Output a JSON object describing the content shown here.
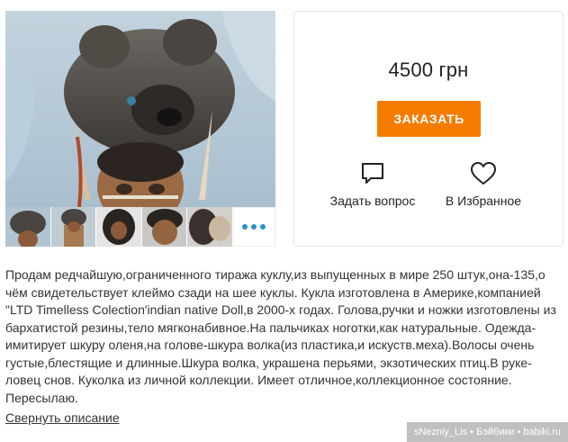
{
  "gallery": {
    "more_label": "•••",
    "main_photo_alt": "Indian native doll in wolf pelt headdress",
    "thumbnails": [
      "thumb-1",
      "thumb-2",
      "thumb-3",
      "thumb-4",
      "thumb-5"
    ]
  },
  "purchase": {
    "price": "4500 грн",
    "order_label": "ЗАКАЗАТЬ",
    "ask_label": "Задать вопрос",
    "favorite_label": "В Избранное",
    "accent_color": "#f57c00"
  },
  "icons": {
    "ask": "speech-bubble-icon",
    "favorite": "heart-icon"
  },
  "description": {
    "text": "Продам редчайшую,ограниченного тиража куклу,из выпущенных в мире 250 штук,она-135,о чём свидетельствует клеймо сзади на шее куклы. Кукла изготовлена в Америке,компанией \"LTD Timelless Colection'indian native Doll,в 2000-х годах. Голова,ручки и ножки изготовлены из бархатистой резины,тело мягконабивное.На пальчиках ноготки,как натуральные. Одежда-имитирует шкуру оленя,на голове-шкура волка(из пластика,и искуств.меха).Волосы очень густые,блестящие и длинные.Шкура волка, украшена перьями, экзотических птиц.В руке-ловец снов. Куколка из личной коллекции. Имеет отличное,коллекционное состояние. Пересылаю.",
    "collapse_label": "Свернуть описание"
  },
  "watermark": "sNezniy_Lis • Бэйбики • babiki.ru"
}
